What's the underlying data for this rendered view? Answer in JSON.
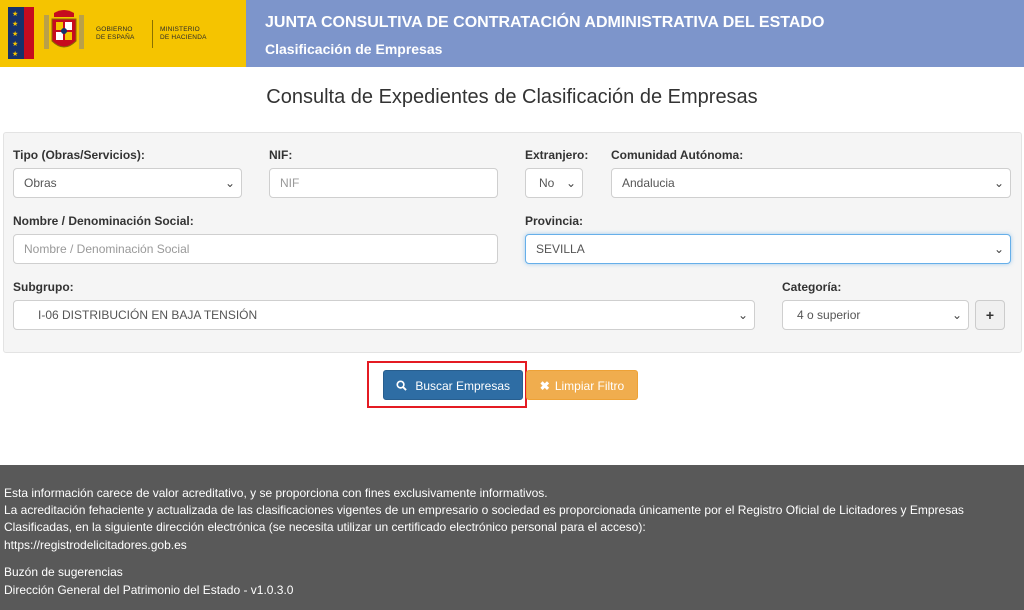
{
  "header": {
    "gov_text": "GOBIERNO\nDE ESPAÑA",
    "min_text": "MINISTERIO\nDE HACIENDA",
    "title": "JUNTA CONSULTIVA DE CONTRATACIÓN ADMINISTRATIVA DEL ESTADO",
    "subtitle": "Clasificación de Empresas"
  },
  "page_title": "Consulta de Expedientes de Clasificación de Empresas",
  "form": {
    "tipo": {
      "label": "Tipo (Obras/Servicios):",
      "value": "Obras"
    },
    "nif": {
      "label": "NIF:",
      "placeholder": "NIF"
    },
    "extranjero": {
      "label": "Extranjero:",
      "value": "No"
    },
    "comunidad": {
      "label": "Comunidad Autónoma:",
      "value": "Andalucia"
    },
    "nombre": {
      "label": "Nombre / Denominación Social:",
      "placeholder": "Nombre / Denominación Social"
    },
    "provincia": {
      "label": "Provincia:",
      "value": "SEVILLA"
    },
    "subgrupo": {
      "label": "Subgrupo:",
      "value": "I-06 DISTRIBUCIÓN EN BAJA TENSIÓN"
    },
    "categoria": {
      "label": "Categoría:",
      "value": "4 o superior",
      "add_label": "+"
    }
  },
  "buttons": {
    "search": {
      "label": "Buscar Empresas",
      "icon": "search-icon"
    },
    "clear": {
      "label": "Limpiar Filtro",
      "icon": "close-icon"
    }
  },
  "footer": {
    "line1": "Esta información carece de valor acreditativo, y se proporciona con fines exclusivamente informativos.",
    "line2": "La acreditación fehaciente y actualizada de las clasificaciones vigentes de un empresario o sociedad es proporcionada únicamente por el Registro Oficial de Licitadores y Empresas",
    "line3": "Clasificadas, en la siguiente dirección electrónica (se necesita utilizar un certificado electrónico personal para el acceso):",
    "link": "https://registrodelicitadores.gob.es",
    "suggestions": "Buzón de sugerencias",
    "version": "Dirección General del Patrimonio del Estado - v1.0.3.0"
  },
  "colors": {
    "header_bg": "#7d95cb",
    "logo_bg": "#f5c400",
    "primary": "#2e6da4",
    "warning": "#f0ad4e",
    "footer_bg": "#595959",
    "highlight": "#e41b23"
  }
}
